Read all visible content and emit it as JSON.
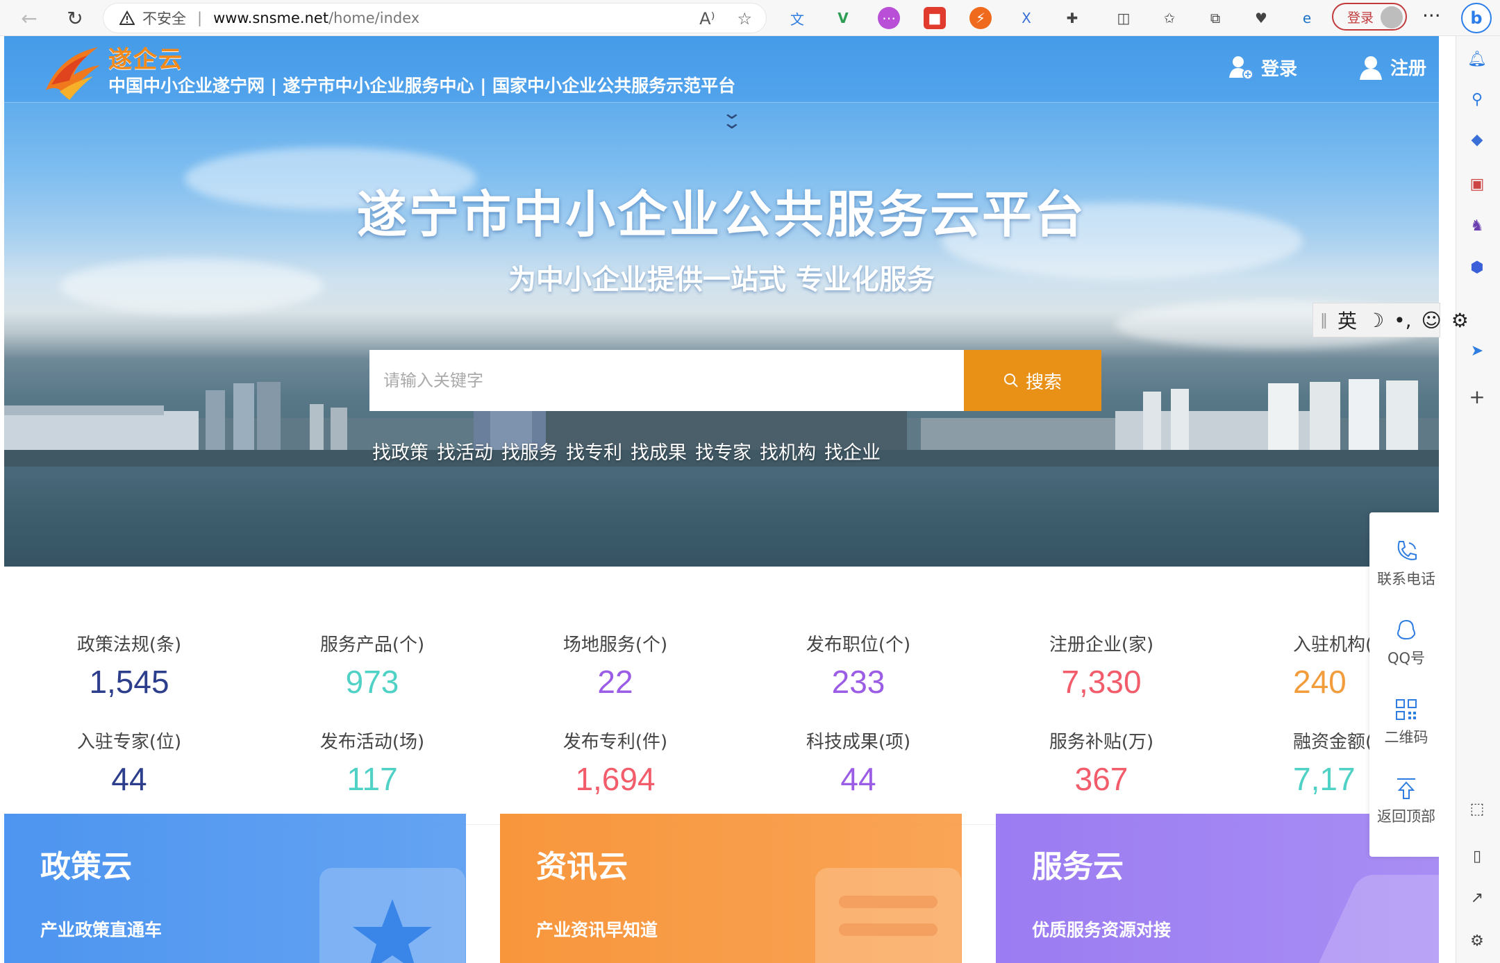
{
  "browser": {
    "insecure_label": "不安全",
    "url_host": "www.snsme.net",
    "url_path": "/home/index",
    "login_label": "登录",
    "more_label": "···",
    "bing_label": "b"
  },
  "ime": {
    "lang": "英",
    "moon": "☽",
    "punct": "•,",
    "emoji": "☺",
    "gear": "⚙"
  },
  "header": {
    "logo_name": "遂企云",
    "site_subtitle": "中国中小企业遂宁网 | 遂宁市中小企业服务中心 | 国家中小企业公共服务示范平台",
    "login_label": "登录",
    "register_label": "注册"
  },
  "hero": {
    "title": "遂宁市中小企业公共服务云平台",
    "subtitle": "为中小企业提供一站式 专业化服务",
    "search_placeholder": "请输入关键字",
    "search_button": "搜索",
    "quick_links": [
      "找政策",
      "找活动",
      "找服务",
      "找专利",
      "找成果",
      "找专家",
      "找机构",
      "找企业"
    ]
  },
  "stats": [
    {
      "label": "政策法规(条)",
      "value": "1,545",
      "color": "#2c3e8c"
    },
    {
      "label": "服务产品(个)",
      "value": "973",
      "color": "#4fd1c5"
    },
    {
      "label": "场地服务(个)",
      "value": "22",
      "color": "#9b5de5"
    },
    {
      "label": "发布职位(个)",
      "value": "233",
      "color": "#9b5de5"
    },
    {
      "label": "注册企业(家)",
      "value": "7,330",
      "color": "#f25c6b"
    },
    {
      "label": "入驻机构(",
      "value": "240",
      "color": "#f39c3c"
    },
    {
      "label": "入驻专家(位)",
      "value": "44",
      "color": "#2c3e8c"
    },
    {
      "label": "发布活动(场)",
      "value": "117",
      "color": "#4fd1c5"
    },
    {
      "label": "发布专利(件)",
      "value": "1,694",
      "color": "#f25c6b"
    },
    {
      "label": "科技成果(项)",
      "value": "44",
      "color": "#9b5de5"
    },
    {
      "label": "服务补贴(万)",
      "value": "367",
      "color": "#f25c6b"
    },
    {
      "label": "融资金额(",
      "value": "7,17",
      "color": "#4fd1c5"
    }
  ],
  "cards": [
    {
      "title": "政策云",
      "subtitle": "产业政策直通车",
      "color": "#4d95f0"
    },
    {
      "title": "资讯云",
      "subtitle": "产业资讯早知道",
      "color": "#f8963c"
    },
    {
      "title": "服务云",
      "subtitle": "优质服务资源对接",
      "color": "#9b7cf2"
    }
  ],
  "float_panel": {
    "phone_label": "联系电话",
    "qq_label": "QQ号",
    "qrcode_label": "二维码",
    "top_label": "返回顶部"
  }
}
